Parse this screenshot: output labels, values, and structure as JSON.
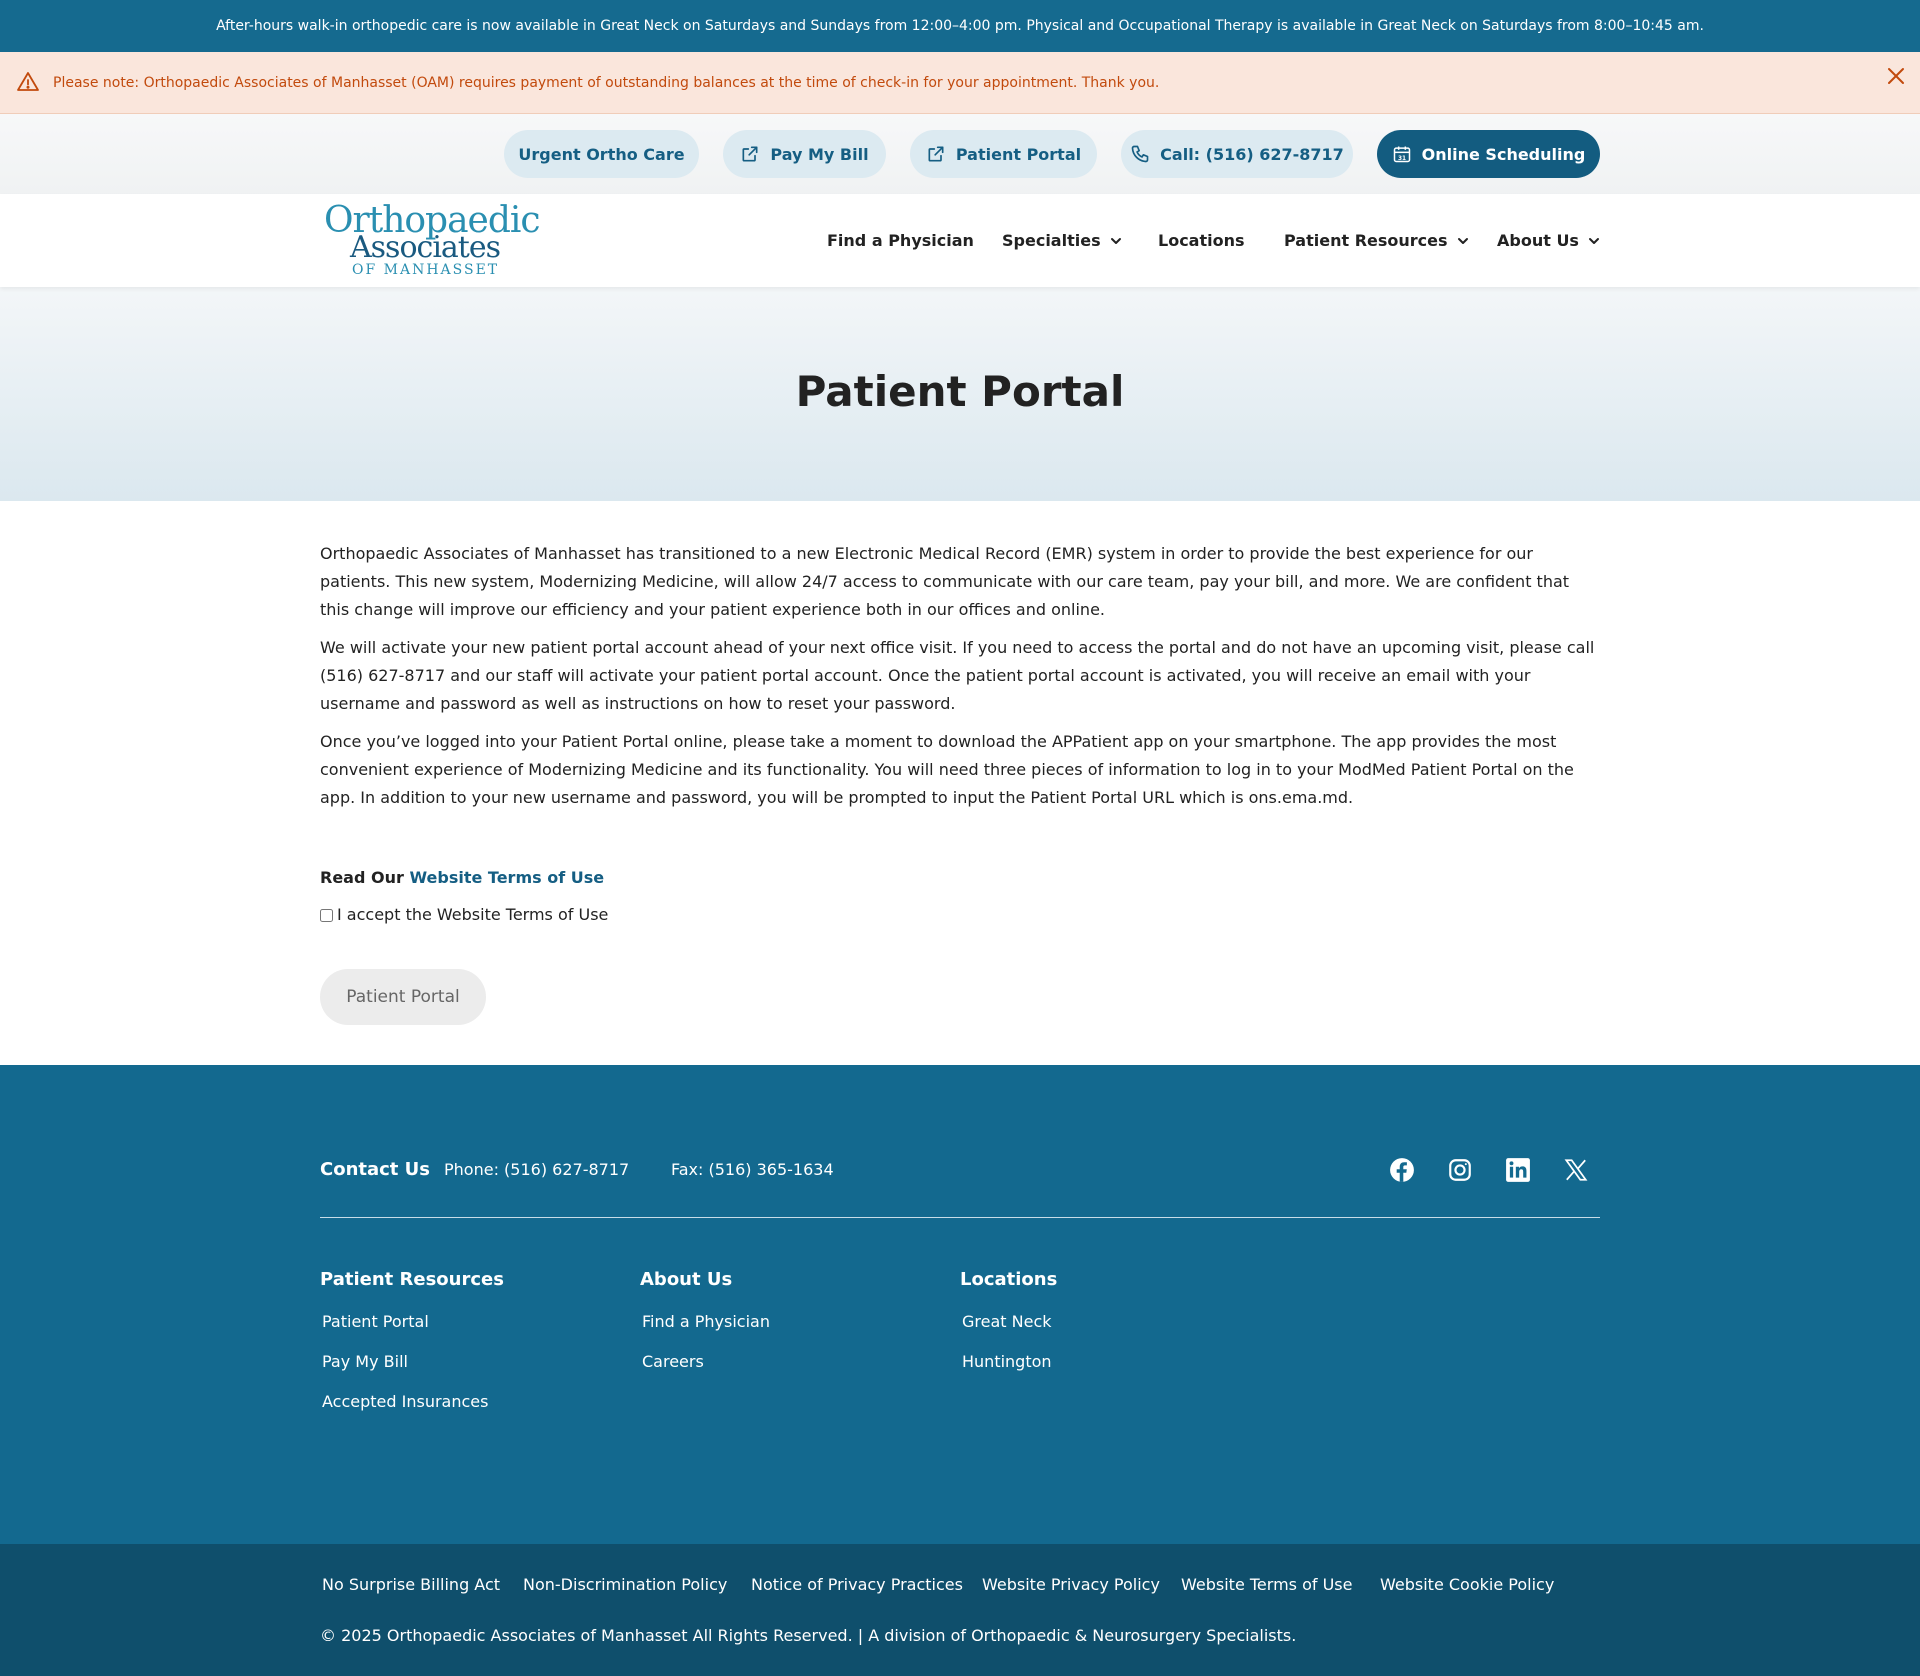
{
  "topbar": {
    "message": "After-hours walk-in orthopedic care is now available in Great Neck on Saturdays and Sundays from 12:00–4:00 pm. Physical and Occupational Therapy is available in Great Neck on Saturdays from 8:00–10:45 am."
  },
  "alert": {
    "message": "Please note: Orthopaedic Associates of Manhasset (OAM) requires payment of outstanding balances at the time of check-in for your appointment. Thank you.",
    "icon": "warning-triangle-icon",
    "close_icon": "close-icon"
  },
  "utility": {
    "urgent": "Urgent Ortho Care",
    "pay_bill": "Pay My Bill",
    "portal": "Patient Portal",
    "call": "Call: (516) 627-8717",
    "scheduling": "Online Scheduling"
  },
  "logo": {
    "line1": "Orthopaedic",
    "line2": "Associates",
    "line3": "OF MANHASSET"
  },
  "nav": {
    "find_physician": "Find a Physician",
    "specialties": "Specialties",
    "locations": "Locations",
    "patient_resources": "Patient Resources",
    "about_us": "About Us"
  },
  "hero": {
    "title": "Patient Portal"
  },
  "content": {
    "paragraphs": [
      "Orthopaedic Associates of Manhasset has transitioned to a new Electronic Medical Record (EMR) system in order to provide the best experience for our patients. This new system, Modernizing Medicine, will allow 24/7 access to communicate with our care team, pay your bill, and more. We are confident that this change will improve our efficiency and your patient experience both in our offices and online.",
      "We will activate your new patient portal account ahead of your next office visit. If you need to access the portal and do not have an upcoming visit, please call (516) 627-8717 and our staff will activate your patient portal account. Once the patient portal account is activated, you will receive an email with your username and password as well as instructions on how to reset your password.",
      "Once you’ve logged into your Patient Portal online, please take a moment to download the APPatient app on your smartphone. The app provides the most convenient experience of Modernizing Medicine and its functionality. You will need three pieces of information to log in to your ModMed Patient Portal on the app. In addition to your new username and password, you will be prompted to input the Patient Portal URL which is ons.ema.md."
    ],
    "terms_prefix": "Read Our ",
    "terms_link": "Website Terms of Use",
    "accept_label": "I accept the Website Terms of Use",
    "accept_checked": false,
    "portal_button": "Patient Portal"
  },
  "footer": {
    "contact_title": "Contact Us",
    "phone": "Phone: (516) 627-8717",
    "fax": "Fax: (516) 365-1634",
    "social_icons": [
      "facebook-icon",
      "instagram-icon",
      "linkedin-icon",
      "x-icon"
    ],
    "columns": [
      {
        "title": "Patient Resources",
        "links": [
          "Patient Portal",
          "Pay My Bill",
          "Accepted Insurances"
        ]
      },
      {
        "title": "About Us",
        "links": [
          "Find a Physician",
          "Careers"
        ]
      },
      {
        "title": "Locations",
        "links": [
          "Great Neck",
          "Huntington"
        ]
      }
    ]
  },
  "bottom": {
    "links": [
      "No Surprise Billing Act",
      "Non-Discrimination Policy",
      "Notice of Privacy Practices",
      "Website Privacy Policy",
      "Website Terms of Use",
      "Website Cookie Policy"
    ],
    "copyright": "© 2025 Orthopaedic Associates of Manhasset All Rights Reserved. | A division of Orthopaedic & Neurosurgery Specialists."
  },
  "colors": {
    "brand_blue": "#135c80",
    "topbar": "#156a8f",
    "footer": "#13698f",
    "bottom_bar": "#0f4f6c",
    "alert_bg": "#fae6dc",
    "alert_text": "#c24a0d",
    "pill_bg": "#dceaf1"
  }
}
